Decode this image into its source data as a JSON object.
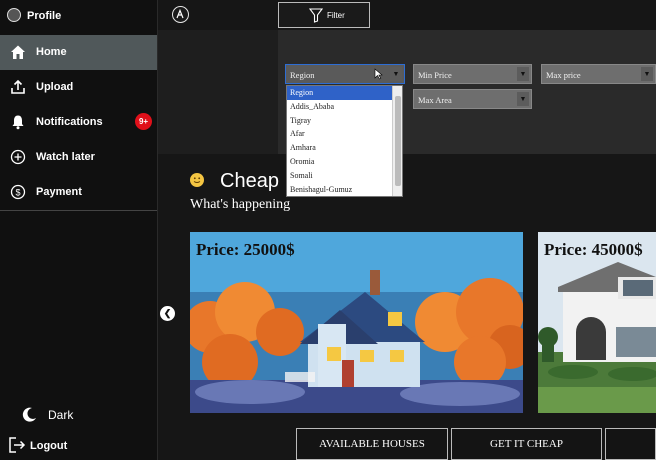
{
  "sidebar": {
    "profile_label": "Profile",
    "items": [
      {
        "label": "Home",
        "icon": "home-icon"
      },
      {
        "label": "Upload",
        "icon": "upload-icon"
      },
      {
        "label": "Notifications",
        "icon": "bell-icon"
      },
      {
        "label": "Watch later",
        "icon": "plus-circle-icon"
      },
      {
        "label": "Payment",
        "icon": "dollar-circle-icon"
      }
    ],
    "notifications_badge": "9+",
    "dark_label": "Dark",
    "logout_label": "Logout"
  },
  "toolbar": {
    "filter_label": "Filter"
  },
  "filters": {
    "region": "Region",
    "min_price": "Min Price",
    "max_price": "Max price",
    "max_area": "Max Area",
    "region_options": [
      "Region",
      "Addis_Ababa",
      "Tigray",
      "Afar",
      "Amhara",
      "Oromia",
      "Somali",
      "Benishagul-Gumuz"
    ]
  },
  "main": {
    "headline": "Cheap",
    "subheading": "What's happening",
    "cards": [
      {
        "price": "Price: 25000$"
      },
      {
        "price": "Price: 45000$"
      }
    ],
    "buttons": [
      "AVAILABLE HOUSES",
      "GET IT CHEAP"
    ]
  },
  "colors": {
    "accent": "#2f62c8",
    "badge": "#e0101a",
    "active_nav": "#50585a"
  }
}
